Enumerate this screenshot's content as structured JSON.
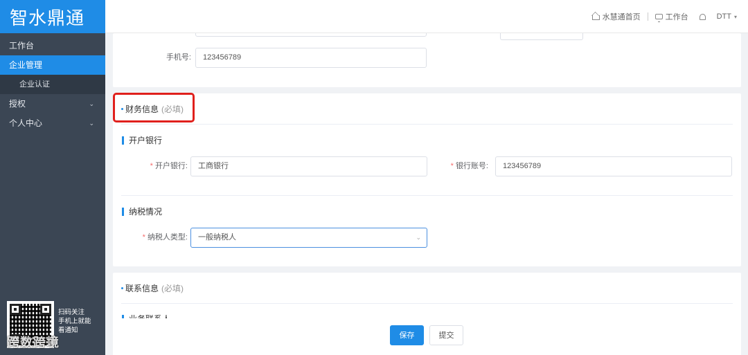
{
  "app": {
    "logo_text": "智水鼎通"
  },
  "sidebar": {
    "items": [
      {
        "label": "工作台"
      },
      {
        "label": "企业管理"
      },
      {
        "label": "企业认证"
      },
      {
        "label": "授权"
      },
      {
        "label": "个人中心"
      }
    ],
    "qr_note": [
      "扫码关注",
      "手机上就能",
      "看通知"
    ],
    "watermark": "跨数跨境"
  },
  "header": {
    "home_label": "水慧通首页",
    "workbench_label": "工作台",
    "user_label": "DTT"
  },
  "form": {
    "phone_label": "手机号:",
    "phone_value": "123456789",
    "finance_section": {
      "title": "财务信息",
      "hint": "(必填)"
    },
    "bank_group": {
      "title": "开户银行",
      "bank_label": "开户银行:",
      "bank_value": "工商银行",
      "account_label": "银行账号:",
      "account_value": "123456789"
    },
    "tax_group": {
      "title": "纳税情况",
      "type_label": "纳税人类型:",
      "type_value": "一般纳税人"
    },
    "contact_section": {
      "title": "联系信息",
      "hint": "(必填)"
    },
    "contact_sub_title": "业务联系人"
  },
  "actions": {
    "save_label": "保存",
    "submit_label": "提交"
  },
  "colors": {
    "primary": "#1f8ce6",
    "sidebar_bg": "#3b4654",
    "highlight": "#e0201c"
  }
}
